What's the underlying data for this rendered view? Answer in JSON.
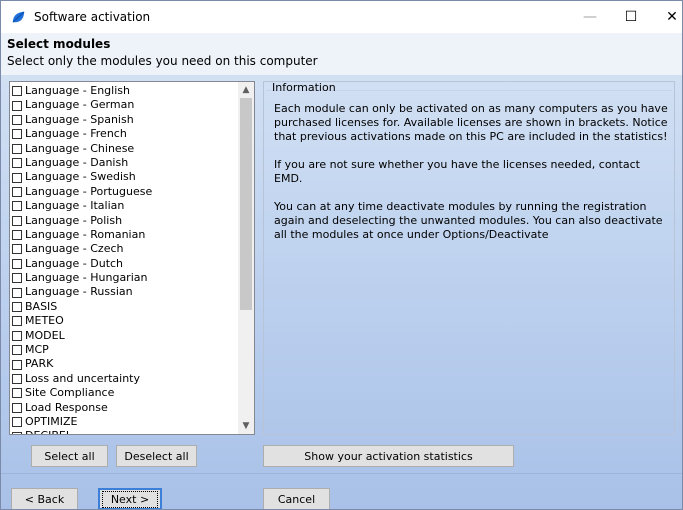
{
  "window": {
    "title": "Software activation",
    "minimize_icon": "minimize-icon",
    "maximize_icon": "maximize-icon",
    "close_icon": "close-icon"
  },
  "header": {
    "title": "Select modules",
    "subtitle": "Select only the modules you need on this computer"
  },
  "modules": [
    "Language - English",
    "Language - German",
    "Language - Spanish",
    "Language - French",
    "Language - Chinese",
    "Language - Danish",
    "Language - Swedish",
    "Language - Portuguese",
    "Language - Italian",
    "Language - Polish",
    "Language - Romanian",
    "Language - Czech",
    "Language - Dutch",
    "Language - Hungarian",
    "Language - Russian",
    "BASIS",
    "METEO",
    "MODEL",
    "MCP",
    "PARK",
    "Loss and uncertainty",
    "Site Compliance",
    "Load Response",
    "OPTIMIZE",
    "DECIBEL"
  ],
  "info": {
    "legend": "Information",
    "paragraphs": [
      "Each module can only be activated on as many computers as you have purchased licenses for.  Available licenses are shown in brackets. Notice that previous activations made on this PC are included in the statistics!",
      "If you are not sure whether you have the licenses needed, contact EMD.",
      "You can at any time deactivate modules by running the registration again and deselecting the unwanted modules. You can also deactivate all the modules at once under Options/Deactivate"
    ]
  },
  "buttons": {
    "select_all": "Select all",
    "deselect_all": "Deselect all",
    "stats": "Show your activation statistics",
    "back": "< Back",
    "next": "Next >",
    "cancel": "Cancel"
  },
  "colors": {
    "accent": "#3c7fd8",
    "app_icon": "#1e6fd9"
  }
}
